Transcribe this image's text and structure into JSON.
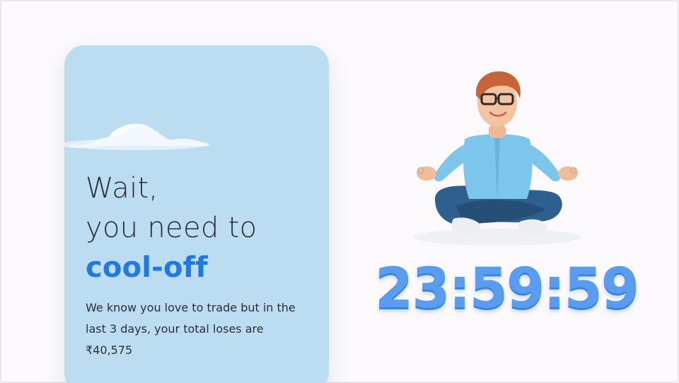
{
  "card": {
    "headline_line1": "Wait,",
    "headline_line2": "you need to",
    "headline_accent": "cool-off",
    "description": "We know you love to trade but in the last 3 days, your total loses are ₹40,575"
  },
  "timer": {
    "value": "23:59:59"
  },
  "colors": {
    "page_background": "#fbf9fc",
    "card_background": "#bcdcf2",
    "accent": "#1e78e6",
    "timer": "#5a9df0"
  },
  "icons": {
    "illustration": "meditating-man-illustration",
    "cloud": "cloud-decoration"
  }
}
